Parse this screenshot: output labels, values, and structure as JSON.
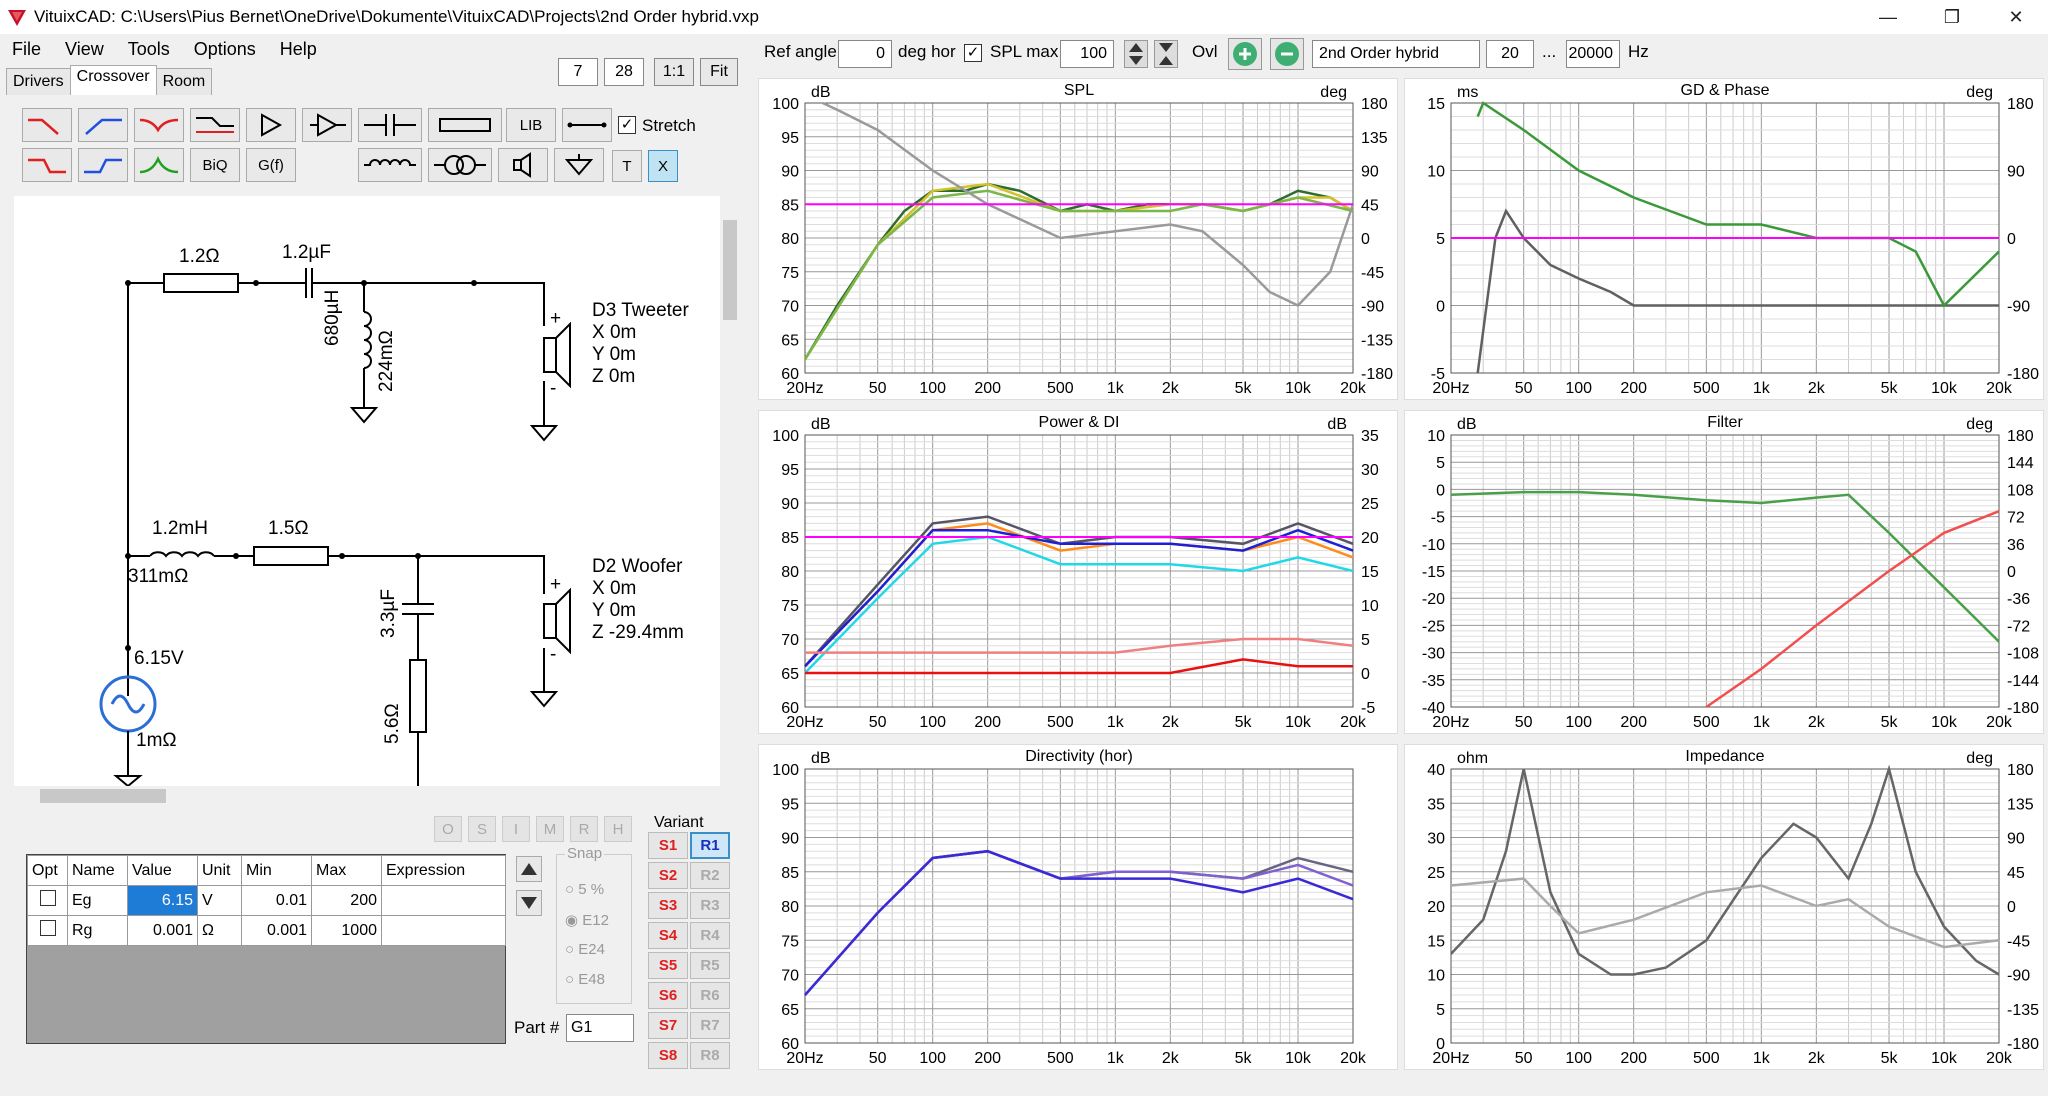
{
  "window": {
    "title": "VituixCAD: C:\\Users\\Pius Bernet\\OneDrive\\Dokumente\\VituixCAD\\Projects\\2nd Order hybrid.vxp",
    "minimize": "—",
    "restore": "❐",
    "close": "✕"
  },
  "menu": [
    "File",
    "View",
    "Tools",
    "Options",
    "Help"
  ],
  "tabs": [
    "Drivers",
    "Crossover",
    "Room"
  ],
  "zoom": {
    "a": "7",
    "b": "28",
    "one": "1:1",
    "fit": "Fit"
  },
  "toolbar": {
    "biq": "BiQ",
    "gf": "G(f)",
    "lib": "LIB",
    "t": "T",
    "x": "X",
    "stretch": "Stretch"
  },
  "circuit": {
    "r1": "1.2Ω",
    "c1": "1.2µF",
    "l1": "680µH",
    "l1r": "224mΩ",
    "tw": [
      "D3 Tweeter",
      "X 0m",
      "Y 0m",
      "Z 0m"
    ],
    "l2": "1.2mH",
    "l2r": "311mΩ",
    "r2": "1.5Ω",
    "c2": "3.3µF",
    "r3": "5.6Ω",
    "wf": [
      "D2 Woofer",
      "X 0m",
      "Y 0m",
      "Z -29.4mm"
    ],
    "src_v": "6.15V",
    "src_r": "1mΩ",
    "plus": "+",
    "minus": "-"
  },
  "opt_buttons": [
    "O",
    "S",
    "I",
    "M",
    "R",
    "H"
  ],
  "table": {
    "headers": [
      "Opt",
      "Name",
      "Value",
      "Unit",
      "Min",
      "Max",
      "Expression"
    ],
    "rows": [
      {
        "name": "Eg",
        "value": "6.15",
        "unit": "V",
        "min": "0.01",
        "max": "200"
      },
      {
        "name": "Rg",
        "value": "0.001",
        "unit": "Ω",
        "min": "0.001",
        "max": "1000"
      }
    ]
  },
  "snap": {
    "label": "Snap",
    "opts": [
      "5 %",
      "E12",
      "E24",
      "E48"
    ]
  },
  "variant": {
    "label": "Variant",
    "s": [
      "S1",
      "S2",
      "S3",
      "S4",
      "S5",
      "S6",
      "S7",
      "S8"
    ],
    "r": [
      "R1",
      "R2",
      "R3",
      "R4",
      "R5",
      "R6",
      "R7",
      "R8"
    ]
  },
  "part": {
    "label": "Part #",
    "value": "G1"
  },
  "topbar": {
    "ref_angle": "Ref angle",
    "ref_value": "0",
    "deg_hor": "deg hor",
    "spl_max": "SPL max",
    "spl_value": "100",
    "ovl": "Ovl",
    "name": "2nd Order hybrid",
    "f_lo": "20",
    "dots": "...",
    "f_hi": "20000",
    "hz": "Hz"
  },
  "freq_ticks": [
    "20Hz",
    "50",
    "100",
    "200",
    "500",
    "1k",
    "2k",
    "5k",
    "10k",
    "20k"
  ],
  "charts": [
    {
      "title": "SPL",
      "left_unit": "dB",
      "right_unit": "deg",
      "left_ticks": [
        "100",
        "95",
        "90",
        "85",
        "80",
        "75",
        "70",
        "65",
        "60"
      ],
      "right_ticks": [
        "180",
        "135",
        "90",
        "45",
        "0",
        "-45",
        "-90",
        "-135",
        "-180"
      ]
    },
    {
      "title": "GD & Phase",
      "left_unit": "ms",
      "right_unit": "deg",
      "left_ticks": [
        "15",
        "10",
        "5",
        "0",
        "-5"
      ],
      "right_ticks": [
        "180",
        "90",
        "0",
        "-90",
        "-180"
      ]
    },
    {
      "title": "Power & DI",
      "left_unit": "dB",
      "right_unit": "dB",
      "left_ticks": [
        "100",
        "95",
        "90",
        "85",
        "80",
        "75",
        "70",
        "65",
        "60"
      ],
      "right_ticks": [
        "35",
        "30",
        "25",
        "20",
        "15",
        "10",
        "5",
        "0",
        "-5"
      ]
    },
    {
      "title": "Filter",
      "left_unit": "dB",
      "right_unit": "deg",
      "left_ticks": [
        "10",
        "5",
        "0",
        "-5",
        "-10",
        "-15",
        "-20",
        "-25",
        "-30",
        "-35",
        "-40"
      ],
      "right_ticks": [
        "180",
        "144",
        "108",
        "72",
        "36",
        "0",
        "-36",
        "-72",
        "-108",
        "-144",
        "-180"
      ]
    },
    {
      "title": "Directivity (hor)",
      "left_unit": "dB",
      "right_unit": "",
      "left_ticks": [
        "100",
        "95",
        "90",
        "85",
        "80",
        "75",
        "70",
        "65",
        "60"
      ],
      "right_ticks": []
    },
    {
      "title": "Impedance",
      "left_unit": "ohm",
      "right_unit": "deg",
      "left_ticks": [
        "40",
        "35",
        "30",
        "25",
        "20",
        "15",
        "10",
        "5",
        "0"
      ],
      "right_ticks": [
        "180",
        "135",
        "90",
        "45",
        "0",
        "-45",
        "-90",
        "-135",
        "-180"
      ]
    }
  ],
  "chart_data": [
    {
      "type": "line",
      "title": "SPL",
      "xlim": [
        20,
        20000
      ],
      "ylim": [
        60,
        100
      ],
      "xscale": "log",
      "ylabel": "dB",
      "series": [
        {
          "color": "#2e6b2e",
          "x": [
            20,
            30,
            50,
            70,
            100,
            150,
            200,
            300,
            500,
            700,
            1000,
            1500,
            2000,
            3000,
            5000,
            7000,
            10000,
            15000,
            20000
          ],
          "y": [
            62,
            70,
            79,
            84,
            87,
            87,
            88,
            87,
            84,
            85,
            84,
            85,
            85,
            85,
            84,
            85,
            87,
            86,
            84
          ]
        },
        {
          "color": "#d4c22a",
          "x": [
            20,
            50,
            100,
            200,
            500,
            1000,
            2000,
            3000,
            5000,
            7000,
            10000,
            15000,
            20000
          ],
          "y": [
            62,
            79,
            87,
            88,
            84,
            84,
            85,
            85,
            84,
            85,
            86,
            86,
            84
          ]
        },
        {
          "color": "#7ab648",
          "x": [
            20,
            50,
            100,
            200,
            500,
            1000,
            2000,
            3000,
            5000,
            7000,
            10000,
            20000
          ],
          "y": [
            62,
            79,
            86,
            87,
            84,
            84,
            84,
            85,
            84,
            85,
            86,
            84
          ]
        },
        {
          "color": "#9a9a9a",
          "x": [
            25,
            30,
            50,
            100,
            200,
            500,
            1000,
            2000,
            3000,
            5000,
            7000,
            10000,
            15000,
            20000
          ],
          "y": [
            100,
            99,
            96,
            90,
            85,
            80,
            81,
            82,
            81,
            76,
            72,
            70,
            75,
            85
          ]
        },
        {
          "color": "#ff00ff",
          "x": [
            20,
            20000
          ],
          "y": [
            85,
            85
          ]
        }
      ]
    },
    {
      "type": "line",
      "title": "GD & Phase",
      "xlim": [
        20,
        20000
      ],
      "ylim": [
        -5,
        15
      ],
      "xscale": "log",
      "ylabel": "ms",
      "series": [
        {
          "color": "#606060",
          "x": [
            28,
            35,
            40,
            50,
            70,
            100,
            150,
            200,
            300,
            500,
            1000,
            2000,
            5000,
            10000,
            20000
          ],
          "y": [
            -5,
            5,
            7,
            5,
            3,
            2,
            1,
            0,
            0,
            0,
            0,
            0,
            0,
            0,
            0
          ]
        },
        {
          "color": "#3a9a3a",
          "x": [
            28,
            30,
            50,
            100,
            200,
            500,
            1000,
            2000,
            5000,
            7000,
            10000,
            20000
          ],
          "y": [
            14,
            15,
            13,
            10,
            8,
            6,
            6,
            5,
            5,
            4,
            0,
            4
          ]
        },
        {
          "color": "#ff00ff",
          "x": [
            20,
            20000
          ],
          "y": [
            5,
            5
          ]
        }
      ]
    },
    {
      "type": "line",
      "title": "Power & DI",
      "xlim": [
        20,
        20000
      ],
      "ylim": [
        60,
        100
      ],
      "xscale": "log",
      "ylabel": "dB",
      "series": [
        {
          "color": "#555566",
          "x": [
            20,
            50,
            100,
            200,
            500,
            1000,
            2000,
            5000,
            10000,
            20000
          ],
          "y": [
            66,
            78,
            87,
            88,
            84,
            85,
            85,
            84,
            87,
            84
          ]
        },
        {
          "color": "#ff8c1a",
          "x": [
            20,
            50,
            100,
            200,
            500,
            1000,
            2000,
            5000,
            10000,
            20000
          ],
          "y": [
            66,
            77,
            86,
            87,
            83,
            84,
            84,
            83,
            85,
            82
          ]
        },
        {
          "color": "#1f1fd6",
          "x": [
            20,
            50,
            100,
            200,
            500,
            1000,
            2000,
            5000,
            10000,
            20000
          ],
          "y": [
            66,
            77,
            86,
            86,
            84,
            84,
            84,
            83,
            86,
            83
          ]
        },
        {
          "color": "#22d8e8",
          "x": [
            20,
            50,
            100,
            200,
            500,
            1000,
            2000,
            5000,
            10000,
            20000
          ],
          "y": [
            65,
            76,
            84,
            85,
            81,
            81,
            81,
            80,
            82,
            80
          ]
        },
        {
          "color": "#f08080",
          "x": [
            20,
            500,
            1000,
            2000,
            5000,
            10000,
            20000
          ],
          "y": [
            68,
            68,
            68,
            69,
            70,
            70,
            69
          ]
        },
        {
          "color": "#e81010",
          "x": [
            20,
            500,
            1000,
            2000,
            5000,
            10000,
            20000
          ],
          "y": [
            65,
            65,
            65,
            65,
            67,
            66,
            66
          ]
        },
        {
          "color": "#ff00ff",
          "x": [
            20,
            20000
          ],
          "y": [
            85,
            85
          ]
        }
      ]
    },
    {
      "type": "line",
      "title": "Filter",
      "xlim": [
        20,
        20000
      ],
      "ylim": [
        -40,
        10
      ],
      "xscale": "log",
      "ylabel": "dB",
      "series": [
        {
          "color": "#4aa04a",
          "x": [
            20,
            50,
            100,
            200,
            500,
            1000,
            2000,
            3000,
            5000,
            10000,
            20000
          ],
          "y": [
            -1,
            -0.5,
            -0.5,
            -1,
            -2,
            -2.5,
            -1.5,
            -1,
            -8,
            -18,
            -28
          ]
        },
        {
          "color": "#f05050",
          "x": [
            500,
            1000,
            2000,
            5000,
            10000,
            20000
          ],
          "y": [
            -40,
            -33,
            -25,
            -15,
            -8,
            -4
          ]
        }
      ]
    },
    {
      "type": "line",
      "title": "Directivity (hor)",
      "xlim": [
        20,
        20000
      ],
      "ylim": [
        60,
        100
      ],
      "xscale": "log",
      "ylabel": "dB",
      "series": [
        {
          "color": "#666680",
          "x": [
            20,
            50,
            100,
            200,
            500,
            1000,
            2000,
            5000,
            10000,
            20000
          ],
          "y": [
            67,
            79,
            87,
            88,
            84,
            85,
            85,
            84,
            87,
            85
          ]
        },
        {
          "color": "#8060d0",
          "x": [
            20,
            50,
            100,
            200,
            500,
            1000,
            2000,
            5000,
            10000,
            20000
          ],
          "y": [
            67,
            79,
            87,
            88,
            84,
            85,
            85,
            84,
            86,
            83
          ]
        },
        {
          "color": "#3a2ad6",
          "x": [
            20,
            50,
            100,
            200,
            500,
            1000,
            2000,
            5000,
            10000,
            20000
          ],
          "y": [
            67,
            79,
            87,
            88,
            84,
            84,
            84,
            82,
            84,
            81
          ]
        }
      ]
    },
    {
      "type": "line",
      "title": "Impedance",
      "xlim": [
        20,
        20000
      ],
      "ylim": [
        0,
        40
      ],
      "xscale": "log",
      "ylabel": "ohm",
      "series": [
        {
          "color": "#666666",
          "x": [
            20,
            30,
            40,
            50,
            70,
            100,
            150,
            200,
            300,
            500,
            1000,
            1500,
            2000,
            3000,
            4000,
            5000,
            7000,
            10000,
            15000,
            20000
          ],
          "y": [
            13,
            18,
            28,
            40,
            22,
            13,
            10,
            10,
            11,
            15,
            27,
            32,
            30,
            24,
            32,
            40,
            25,
            17,
            12,
            10
          ]
        },
        {
          "color": "#aaaaaa",
          "x": [
            20,
            50,
            70,
            100,
            200,
            500,
            1000,
            2000,
            3000,
            5000,
            10000,
            20000
          ],
          "y": [
            23,
            24,
            20,
            16,
            18,
            22,
            23,
            20,
            21,
            17,
            14,
            15
          ]
        }
      ]
    }
  ]
}
